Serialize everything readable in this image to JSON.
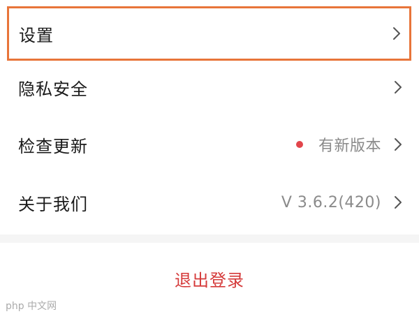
{
  "menu": {
    "items": [
      {
        "label": "设置",
        "value": "",
        "has_dot": false,
        "highlighted": true
      },
      {
        "label": "隐私安全",
        "value": "",
        "has_dot": false,
        "highlighted": false
      },
      {
        "label": "检查更新",
        "value": "有新版本",
        "has_dot": true,
        "highlighted": false
      },
      {
        "label": "关于我们",
        "value": "V 3.6.2(420)",
        "has_dot": false,
        "highlighted": false
      }
    ]
  },
  "logout": {
    "label": "退出登录"
  },
  "watermark": {
    "text": "php 中文网"
  },
  "colors": {
    "highlight_border": "#e8753a",
    "dot": "#e2454b",
    "logout_text": "#d53a3a",
    "background": "#f5f5f5"
  }
}
